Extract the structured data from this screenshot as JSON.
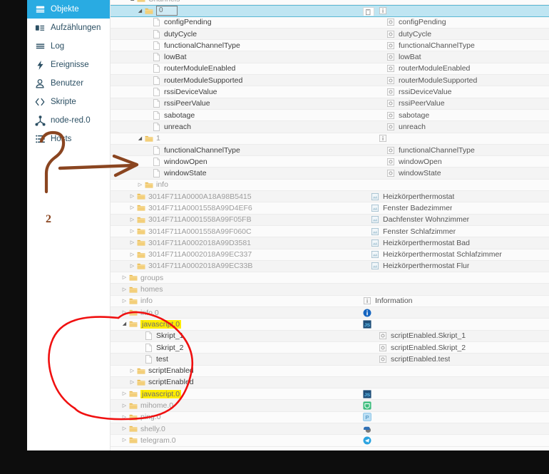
{
  "sidebar": {
    "items": [
      {
        "label": "Objekte",
        "icon": "objects-icon",
        "active": true
      },
      {
        "label": "Aufzählungen",
        "icon": "enums-icon",
        "active": false
      },
      {
        "label": "Log",
        "icon": "log-icon",
        "active": false
      },
      {
        "label": "Ereignisse",
        "icon": "events-icon",
        "active": false
      },
      {
        "label": "Benutzer",
        "icon": "user-icon",
        "active": false
      },
      {
        "label": "Skripte",
        "icon": "code-icon",
        "active": false
      },
      {
        "label": "node-red.0",
        "icon": "node-red-icon",
        "active": false
      },
      {
        "label": "Hosts",
        "icon": "hosts-icon",
        "active": false
      }
    ]
  },
  "tree": {
    "rows": [
      {
        "name": "Channels",
        "value": "",
        "indent": 2,
        "icon": "folder",
        "twisty": "open",
        "state": "dim",
        "partial": true
      },
      {
        "name": "0",
        "value": "",
        "indent": 3,
        "icon": "folder",
        "twisty": "open",
        "state": "selected",
        "edit": true,
        "copy": true,
        "valueIcon": "state-info"
      },
      {
        "name": "configPending",
        "value": "configPending",
        "indent": 4,
        "icon": "file",
        "twisty": "none",
        "state": "normal",
        "valueIcon": "state-dot"
      },
      {
        "name": "dutyCycle",
        "value": "dutyCycle",
        "indent": 4,
        "icon": "file",
        "twisty": "none",
        "state": "normal",
        "valueIcon": "state-dot"
      },
      {
        "name": "functionalChannelType",
        "value": "functionalChannelType",
        "indent": 4,
        "icon": "file",
        "twisty": "none",
        "state": "normal",
        "valueIcon": "state-dot"
      },
      {
        "name": "lowBat",
        "value": "lowBat",
        "indent": 4,
        "icon": "file",
        "twisty": "none",
        "state": "normal",
        "valueIcon": "state-dot"
      },
      {
        "name": "routerModuleEnabled",
        "value": "routerModuleEnabled",
        "indent": 4,
        "icon": "file",
        "twisty": "none",
        "state": "normal",
        "valueIcon": "state-dot"
      },
      {
        "name": "routerModuleSupported",
        "value": "routerModuleSupported",
        "indent": 4,
        "icon": "file",
        "twisty": "none",
        "state": "normal",
        "valueIcon": "state-dot"
      },
      {
        "name": "rssiDeviceValue",
        "value": "rssiDeviceValue",
        "indent": 4,
        "icon": "file",
        "twisty": "none",
        "state": "normal",
        "valueIcon": "state-dot"
      },
      {
        "name": "rssiPeerValue",
        "value": "rssiPeerValue",
        "indent": 4,
        "icon": "file",
        "twisty": "none",
        "state": "normal",
        "valueIcon": "state-dot"
      },
      {
        "name": "sabotage",
        "value": "sabotage",
        "indent": 4,
        "icon": "file",
        "twisty": "none",
        "state": "normal",
        "valueIcon": "state-dot"
      },
      {
        "name": "unreach",
        "value": "unreach",
        "indent": 4,
        "icon": "file",
        "twisty": "none",
        "state": "normal",
        "valueIcon": "state-dot"
      },
      {
        "name": "1",
        "value": "",
        "indent": 3,
        "icon": "folder",
        "twisty": "open",
        "state": "dim",
        "valueIcon": "state-info"
      },
      {
        "name": "functionalChannelType",
        "value": "functionalChannelType",
        "indent": 4,
        "icon": "file",
        "twisty": "none",
        "state": "normal",
        "valueIcon": "state-dot"
      },
      {
        "name": "windowOpen",
        "value": "windowOpen",
        "indent": 4,
        "icon": "file",
        "twisty": "none",
        "state": "normal",
        "valueIcon": "state-dot"
      },
      {
        "name": "windowState",
        "value": "windowState",
        "indent": 4,
        "icon": "file",
        "twisty": "none",
        "state": "normal",
        "valueIcon": "state-dot"
      },
      {
        "name": "info",
        "value": "",
        "indent": 3,
        "icon": "folder",
        "twisty": "closed",
        "state": "dim"
      },
      {
        "name": "3014F711A0000A18A98B5415",
        "value": "Heizkörperthermostat",
        "indent": 2,
        "icon": "folder",
        "twisty": "closed",
        "state": "dim",
        "valueIcon": "channel"
      },
      {
        "name": "3014F711A0001558A99D4EF6",
        "value": "Fenster Badezimmer",
        "indent": 2,
        "icon": "folder",
        "twisty": "closed",
        "state": "dim",
        "valueIcon": "channel"
      },
      {
        "name": "3014F711A0001558A99F05FB",
        "value": "Dachfenster Wohnzimmer",
        "indent": 2,
        "icon": "folder",
        "twisty": "closed",
        "state": "dim",
        "valueIcon": "channel"
      },
      {
        "name": "3014F711A0001558A99F060C",
        "value": "Fenster Schlafzimmer",
        "indent": 2,
        "icon": "folder",
        "twisty": "closed",
        "state": "dim",
        "valueIcon": "channel"
      },
      {
        "name": "3014F711A0002018A99D3581",
        "value": "Heizkörperthermostat Bad",
        "indent": 2,
        "icon": "folder",
        "twisty": "closed",
        "state": "dim",
        "valueIcon": "channel"
      },
      {
        "name": "3014F711A0002018A99EC337",
        "value": "Heizkörperthermostat Schlafzimmer",
        "indent": 2,
        "icon": "folder",
        "twisty": "closed",
        "state": "dim",
        "valueIcon": "channel"
      },
      {
        "name": "3014F711A0002018A99EC33B",
        "value": "Heizkörperthermostat Flur",
        "indent": 2,
        "icon": "folder",
        "twisty": "closed",
        "state": "dim",
        "valueIcon": "channel"
      },
      {
        "name": "groups",
        "value": "",
        "indent": 1,
        "icon": "folder",
        "twisty": "closed",
        "state": "dim"
      },
      {
        "name": "homes",
        "value": "",
        "indent": 1,
        "icon": "folder",
        "twisty": "closed",
        "state": "dim"
      },
      {
        "name": "info",
        "value": "Information",
        "indent": 1,
        "icon": "folder",
        "twisty": "closed",
        "state": "dim",
        "valueIcon": "state-info"
      },
      {
        "name": "info.0",
        "value": "",
        "indent": 1,
        "icon": "folder",
        "twisty": "closed",
        "state": "dim",
        "valueIcon": "adapter-info"
      },
      {
        "name": "javascript.0",
        "value": "",
        "indent": 1,
        "icon": "folder",
        "twisty": "open",
        "state": "highlight",
        "valueIcon": "adapter-js"
      },
      {
        "name": "Skript_1",
        "value": "scriptEnabled.Skript_1",
        "indent": 3,
        "icon": "file",
        "twisty": "none",
        "state": "normal",
        "valueIcon": "state-dot"
      },
      {
        "name": "Skript_2",
        "value": "scriptEnabled.Skript_2",
        "indent": 3,
        "icon": "file",
        "twisty": "none",
        "state": "normal",
        "valueIcon": "state-dot"
      },
      {
        "name": "test",
        "value": "scriptEnabled.test",
        "indent": 3,
        "icon": "file",
        "twisty": "none",
        "state": "normal",
        "valueIcon": "state-dot"
      },
      {
        "name": "scriptEnabled",
        "value": "",
        "indent": 2,
        "icon": "folder",
        "twisty": "closed",
        "state": "normal"
      },
      {
        "name": "scriptEnabled",
        "value": "",
        "indent": 2,
        "icon": "folder",
        "twisty": "closed",
        "state": "normal"
      },
      {
        "name": "javascript.0",
        "value": "",
        "indent": 1,
        "icon": "folder",
        "twisty": "closed",
        "state": "highlight",
        "valueIcon": "adapter-js"
      },
      {
        "name": "mihome.0",
        "value": "",
        "indent": 1,
        "icon": "folder",
        "twisty": "closed",
        "state": "dim",
        "valueIcon": "adapter-mihome"
      },
      {
        "name": "ping.0",
        "value": "",
        "indent": 1,
        "icon": "folder",
        "twisty": "closed",
        "state": "dim",
        "valueIcon": "adapter-ping"
      },
      {
        "name": "shelly.0",
        "value": "",
        "indent": 1,
        "icon": "folder",
        "twisty": "closed",
        "state": "dim",
        "valueIcon": "adapter-shelly"
      },
      {
        "name": "telegram.0",
        "value": "",
        "indent": 1,
        "icon": "folder",
        "twisty": "closed",
        "state": "dim",
        "valueIcon": "adapter-telegram"
      }
    ]
  },
  "annotations": {
    "question_mark": "?",
    "second_mark": "2",
    "arrow_target": "windowOpen",
    "arrow_color": "#8a4520",
    "circle_color": "#f01010",
    "highlight_color": "#ffed00"
  }
}
